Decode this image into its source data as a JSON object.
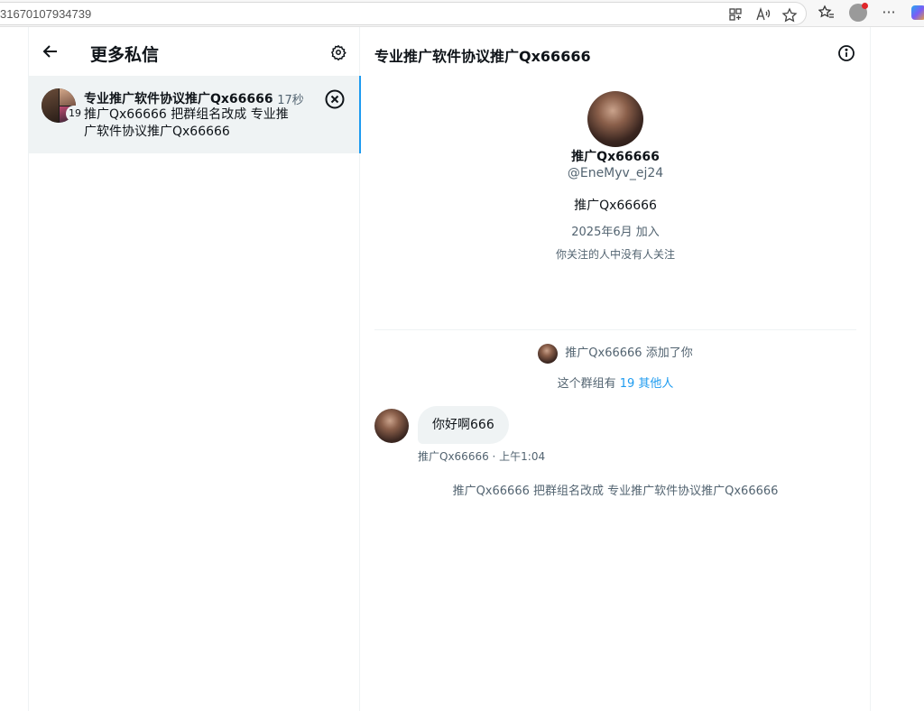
{
  "browser": {
    "url": "31670107934739"
  },
  "left": {
    "title": "更多私信",
    "conversation": {
      "title": "专业推广软件协议推广Qx66666",
      "time": "· 17秒",
      "member_count": "19",
      "preview": "推广Qx66666 把群组名改成 专业推广软件协议推广Qx66666"
    }
  },
  "right": {
    "header_title": "专业推广软件协议推广Qx66666",
    "profile": {
      "name": "推广Qx66666",
      "handle": "@EneMyv_ej24",
      "bio": "推广Qx66666",
      "joined": "2025年6月 加入",
      "followers_note": "你关注的人中没有人关注"
    },
    "events": {
      "added_text": "推广Qx66666 添加了你",
      "group_prefix": "这个群组有",
      "group_link": "19 其他人",
      "rename_text": "推广Qx66666 把群组名改成 专业推广软件协议推广Qx66666"
    },
    "message": {
      "text": "你好啊666",
      "meta": "推广Qx66666 · 上午1:04"
    }
  },
  "colors": {
    "accent": "#1d9bf0",
    "selected_bg": "#eff3f4",
    "secondary_text": "#536471"
  }
}
